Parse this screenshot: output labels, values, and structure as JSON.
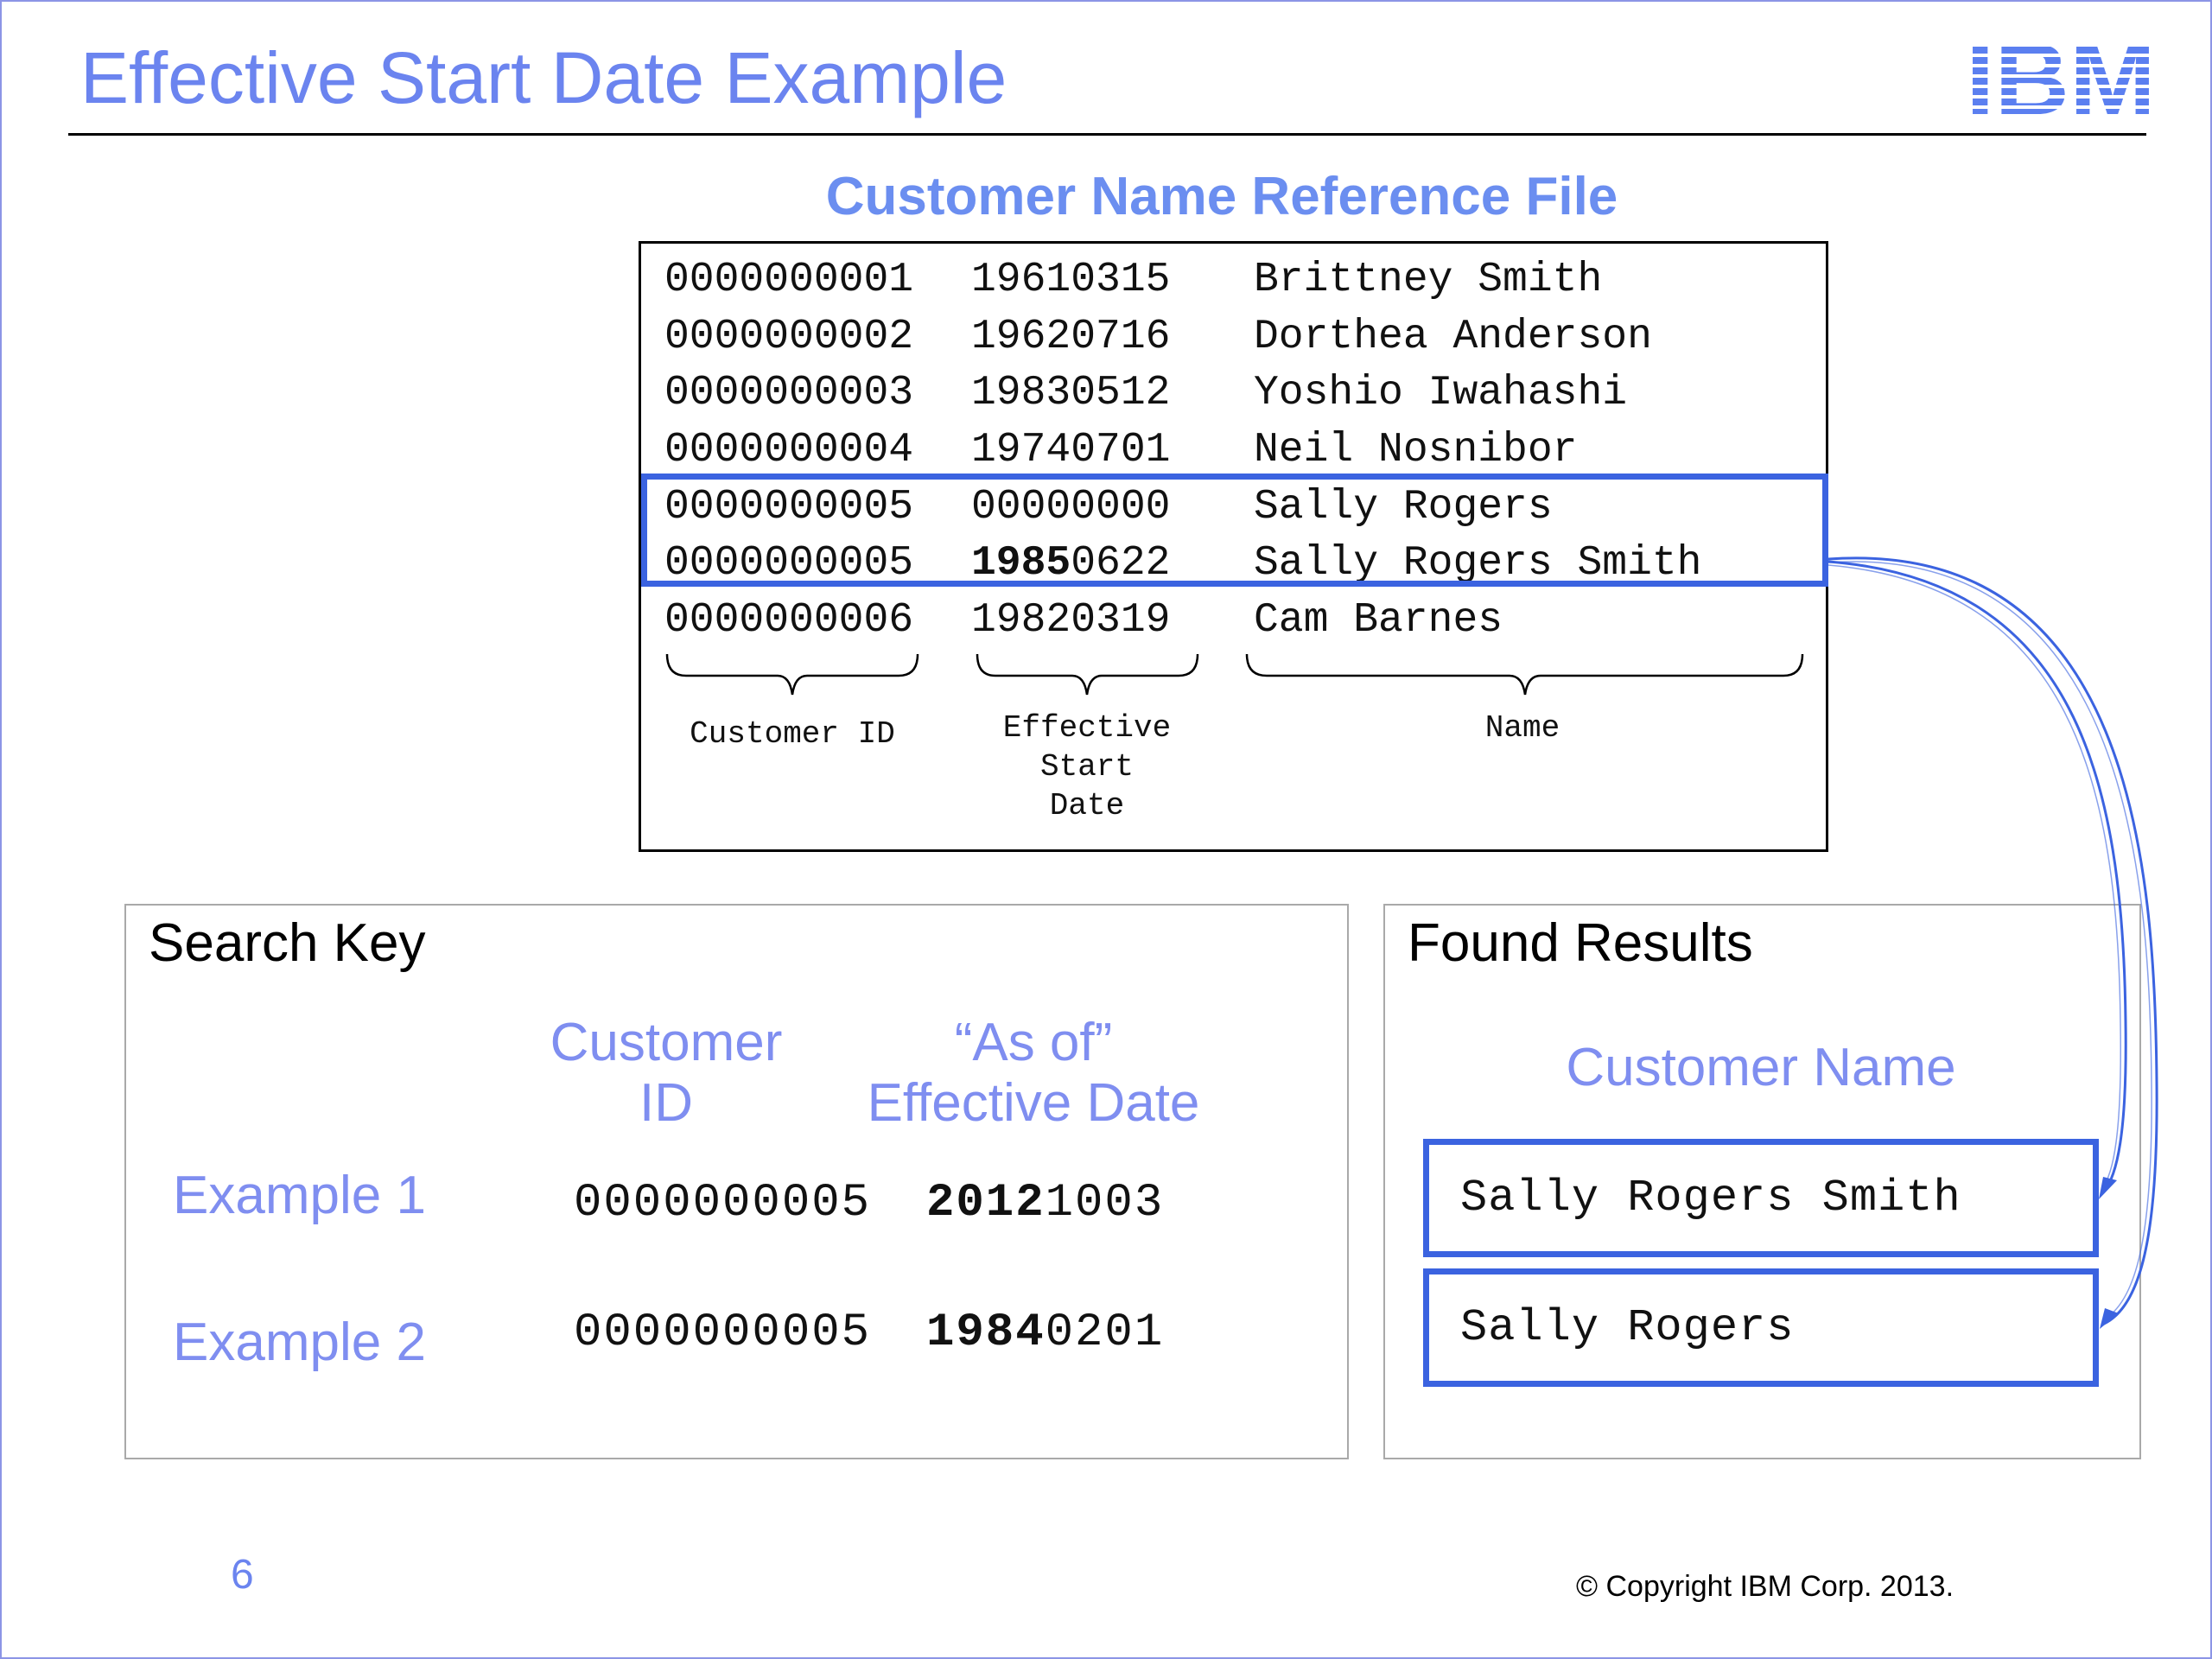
{
  "slide": {
    "title": "Effective Start Date Example",
    "logo_text": "IBM",
    "page_number": "6",
    "copyright": "© Copyright IBM Corp. 2013."
  },
  "reference_file": {
    "title": "Customer Name Reference File",
    "rows": [
      {
        "id": "0000000001",
        "date_bold": "",
        "date_rest": "19610315",
        "name": "Brittney Smith"
      },
      {
        "id": "0000000002",
        "date_bold": "",
        "date_rest": "19620716",
        "name": "Dorthea Anderson"
      },
      {
        "id": "0000000003",
        "date_bold": "",
        "date_rest": "19830512",
        "name": "Yoshio Iwahashi"
      },
      {
        "id": "0000000004",
        "date_bold": "",
        "date_rest": "19740701",
        "name": "Neil Nosnibor"
      },
      {
        "id": "0000000005",
        "date_bold": "",
        "date_rest": "00000000",
        "name": "Sally Rogers"
      },
      {
        "id": "0000000005",
        "date_bold": "1985",
        "date_rest": "0622",
        "name": "Sally Rogers Smith"
      },
      {
        "id": "0000000006",
        "date_bold": "",
        "date_rest": "19820319",
        "name": "Cam Barnes"
      }
    ],
    "column_labels": {
      "customer_id": "Customer ID",
      "effective_start_date": [
        "Effective",
        "Start",
        "Date"
      ],
      "name": "Name"
    }
  },
  "search_key": {
    "heading": "Search Key",
    "col_customer_id": [
      "Customer",
      "ID"
    ],
    "col_as_of": [
      "“As of”",
      "Effective Date"
    ],
    "examples": [
      {
        "label": "Example 1",
        "id": "0000000005",
        "date_bold": "2012",
        "date_rest": "1003"
      },
      {
        "label": "Example 2",
        "id": "0000000005",
        "date_bold": "1984",
        "date_rest": "0201"
      }
    ]
  },
  "found_results": {
    "heading": "Found Results",
    "column": "Customer Name",
    "results": [
      "Sally Rogers Smith",
      "Sally Rogers"
    ]
  },
  "colors": {
    "title_blue": "#6b84ef",
    "label_blue": "#7f8ef0",
    "highlight_blue": "#3b63e0"
  }
}
